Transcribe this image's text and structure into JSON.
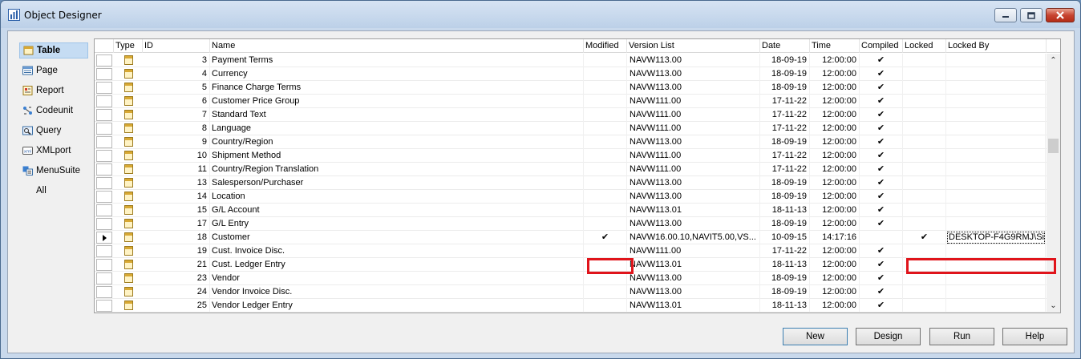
{
  "window": {
    "title": "Object Designer",
    "icon": "object-designer-icon"
  },
  "nav": {
    "items": [
      {
        "label": "Table",
        "icon": "table-icon",
        "active": true
      },
      {
        "label": "Page",
        "icon": "page-icon"
      },
      {
        "label": "Report",
        "icon": "report-icon"
      },
      {
        "label": "Codeunit",
        "icon": "codeunit-icon"
      },
      {
        "label": "Query",
        "icon": "query-icon"
      },
      {
        "label": "XMLport",
        "icon": "xmlport-icon"
      },
      {
        "label": "MenuSuite",
        "icon": "menusuite-icon"
      },
      {
        "label": "All",
        "icon": ""
      }
    ]
  },
  "grid": {
    "columns": {
      "type": "Type",
      "id": "ID",
      "name": "Name",
      "modified": "Modified",
      "version_list": "Version List",
      "date": "Date",
      "time": "Time",
      "compiled": "Compiled",
      "locked": "Locked",
      "locked_by": "Locked By"
    },
    "check_glyph": "✔",
    "rows": [
      {
        "id": "3",
        "name": "Payment Terms",
        "modified": "",
        "version": "NAVW113.00",
        "date": "18-09-19",
        "time": "12:00:00",
        "compiled": "✔",
        "locked": "",
        "locked_by": ""
      },
      {
        "id": "4",
        "name": "Currency",
        "modified": "",
        "version": "NAVW113.00",
        "date": "18-09-19",
        "time": "12:00:00",
        "compiled": "✔",
        "locked": "",
        "locked_by": ""
      },
      {
        "id": "5",
        "name": "Finance Charge Terms",
        "modified": "",
        "version": "NAVW113.00",
        "date": "18-09-19",
        "time": "12:00:00",
        "compiled": "✔",
        "locked": "",
        "locked_by": ""
      },
      {
        "id": "6",
        "name": "Customer Price Group",
        "modified": "",
        "version": "NAVW111.00",
        "date": "17-11-22",
        "time": "12:00:00",
        "compiled": "✔",
        "locked": "",
        "locked_by": ""
      },
      {
        "id": "7",
        "name": "Standard Text",
        "modified": "",
        "version": "NAVW111.00",
        "date": "17-11-22",
        "time": "12:00:00",
        "compiled": "✔",
        "locked": "",
        "locked_by": ""
      },
      {
        "id": "8",
        "name": "Language",
        "modified": "",
        "version": "NAVW111.00",
        "date": "17-11-22",
        "time": "12:00:00",
        "compiled": "✔",
        "locked": "",
        "locked_by": ""
      },
      {
        "id": "9",
        "name": "Country/Region",
        "modified": "",
        "version": "NAVW113.00",
        "date": "18-09-19",
        "time": "12:00:00",
        "compiled": "✔",
        "locked": "",
        "locked_by": ""
      },
      {
        "id": "10",
        "name": "Shipment Method",
        "modified": "",
        "version": "NAVW111.00",
        "date": "17-11-22",
        "time": "12:00:00",
        "compiled": "✔",
        "locked": "",
        "locked_by": ""
      },
      {
        "id": "11",
        "name": "Country/Region Translation",
        "modified": "",
        "version": "NAVW111.00",
        "date": "17-11-22",
        "time": "12:00:00",
        "compiled": "✔",
        "locked": "",
        "locked_by": ""
      },
      {
        "id": "13",
        "name": "Salesperson/Purchaser",
        "modified": "",
        "version": "NAVW113.00",
        "date": "18-09-19",
        "time": "12:00:00",
        "compiled": "✔",
        "locked": "",
        "locked_by": ""
      },
      {
        "id": "14",
        "name": "Location",
        "modified": "",
        "version": "NAVW113.00",
        "date": "18-09-19",
        "time": "12:00:00",
        "compiled": "✔",
        "locked": "",
        "locked_by": ""
      },
      {
        "id": "15",
        "name": "G/L Account",
        "modified": "",
        "version": "NAVW113.01",
        "date": "18-11-13",
        "time": "12:00:00",
        "compiled": "✔",
        "locked": "",
        "locked_by": ""
      },
      {
        "id": "17",
        "name": "G/L Entry",
        "modified": "",
        "version": "NAVW113.00",
        "date": "18-09-19",
        "time": "12:00:00",
        "compiled": "✔",
        "locked": "",
        "locked_by": ""
      },
      {
        "id": "18",
        "name": "Customer",
        "modified": "✔",
        "version": "NAVW16.00.10,NAVIT5.00,VS...",
        "date": "10-09-15",
        "time": "14:17:16",
        "compiled": "",
        "locked": "✔",
        "locked_by": "DESKTOP-F4G9RMJ\\Si...",
        "current": true
      },
      {
        "id": "19",
        "name": "Cust. Invoice Disc.",
        "modified": "",
        "version": "NAVW111.00",
        "date": "17-11-22",
        "time": "12:00:00",
        "compiled": "✔",
        "locked": "",
        "locked_by": ""
      },
      {
        "id": "21",
        "name": "Cust. Ledger Entry",
        "modified": "",
        "version": "NAVW113.01",
        "date": "18-11-13",
        "time": "12:00:00",
        "compiled": "✔",
        "locked": "",
        "locked_by": ""
      },
      {
        "id": "23",
        "name": "Vendor",
        "modified": "",
        "version": "NAVW113.00",
        "date": "18-09-19",
        "time": "12:00:00",
        "compiled": "✔",
        "locked": "",
        "locked_by": ""
      },
      {
        "id": "24",
        "name": "Vendor Invoice Disc.",
        "modified": "",
        "version": "NAVW113.00",
        "date": "18-09-19",
        "time": "12:00:00",
        "compiled": "✔",
        "locked": "",
        "locked_by": ""
      },
      {
        "id": "25",
        "name": "Vendor Ledger Entry",
        "modified": "",
        "version": "NAVW113.01",
        "date": "18-11-13",
        "time": "12:00:00",
        "compiled": "✔",
        "locked": "",
        "locked_by": ""
      }
    ]
  },
  "buttons": {
    "new": "New",
    "design": "Design",
    "run": "Run",
    "help": "Help"
  },
  "colors": {
    "highlight": "#e0141b",
    "active_nav": "#c5dcf3"
  }
}
